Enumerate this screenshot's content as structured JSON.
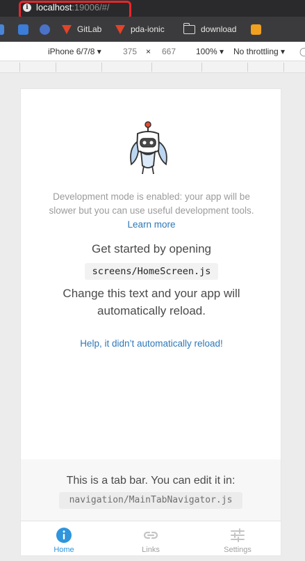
{
  "browser": {
    "url_host": "localhost",
    "url_rest": ":19006/#/"
  },
  "bookmarks": [
    {
      "label": "",
      "icon": "bookmark-blue-icon",
      "color": "#3b7dd8"
    },
    {
      "label": "",
      "icon": "bookmark-swirl-icon",
      "color": "#4a72c9"
    },
    {
      "label": "GitLab",
      "icon": "gitlab-icon",
      "color": "#e24329"
    },
    {
      "label": "pda-ionic",
      "icon": "gitlab-icon",
      "color": "#e24329"
    },
    {
      "label": "download",
      "icon": "folder-icon",
      "color": "#dcdcdc"
    },
    {
      "label": "",
      "icon": "bookmark-orange-icon",
      "color": "#f2a01f"
    }
  ],
  "device_toolbar": {
    "device": "iPhone 6/7/8 ▾",
    "width": "375",
    "times": "×",
    "height": "667",
    "zoom": "100% ▾",
    "throttling": "No throttling ▾"
  },
  "app": {
    "dev_message": "Development mode is enabled: your app will be slower but you can use useful development tools.",
    "learn_more": "Learn more",
    "get_started": "Get started by opening",
    "file_path": "screens/HomeScreen.js",
    "change_text": "Change this text and your app will automatically reload.",
    "help_link": "Help, it didn’t automatically reload!",
    "tabbar_info": "This is a tab bar. You can edit it in:",
    "tabbar_file": "navigation/MainTabNavigator.js",
    "accent_color": "#2f95dc",
    "link_color": "#2e78b7"
  },
  "tabs": [
    {
      "label": "Home",
      "icon": "info-icon",
      "active": true
    },
    {
      "label": "Links",
      "icon": "link-icon",
      "active": false
    },
    {
      "label": "Settings",
      "icon": "sliders-icon",
      "active": false
    }
  ]
}
